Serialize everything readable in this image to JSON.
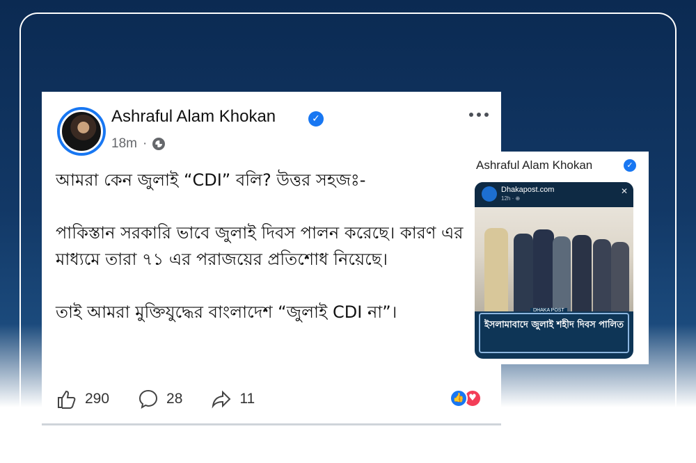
{
  "post": {
    "author": "Ashraful Alam Khokan",
    "time": "18m",
    "separator": "·",
    "body": "আমরা কেন জুলাই “CDI” বলি? উত্তর সহজঃ-\n\nপাকিস্তান সরকারি ভাবে জুলাই দিবস পালন করেছে। কারণ এর মাধ্যমে তারা ৭১ এর পরাজয়ের প্রতিশোধ নিয়েছে।\n\nতাই আমরা মুক্তিযুদ্ধের বাংলাদেশ “জুলাই CDI না”।",
    "likes": "290",
    "comments": "28",
    "shares": "11"
  },
  "inset": {
    "author": "Ashraful Alam Khokan",
    "screenshot": {
      "source": "Dhakapost.com",
      "time": "12h · ⊕",
      "close": "✕",
      "brand": "DHAKA POST",
      "headline": "ইসলামাবাদে জুলাই শহীদ দিবস পালিত"
    }
  },
  "colors": {
    "accent": "#1877f2",
    "love": "#f33e58",
    "background_top": "#0b2a52"
  },
  "icons": [
    "globe-icon",
    "verified-icon",
    "more-icon",
    "like-icon",
    "comment-icon",
    "share-icon"
  ]
}
